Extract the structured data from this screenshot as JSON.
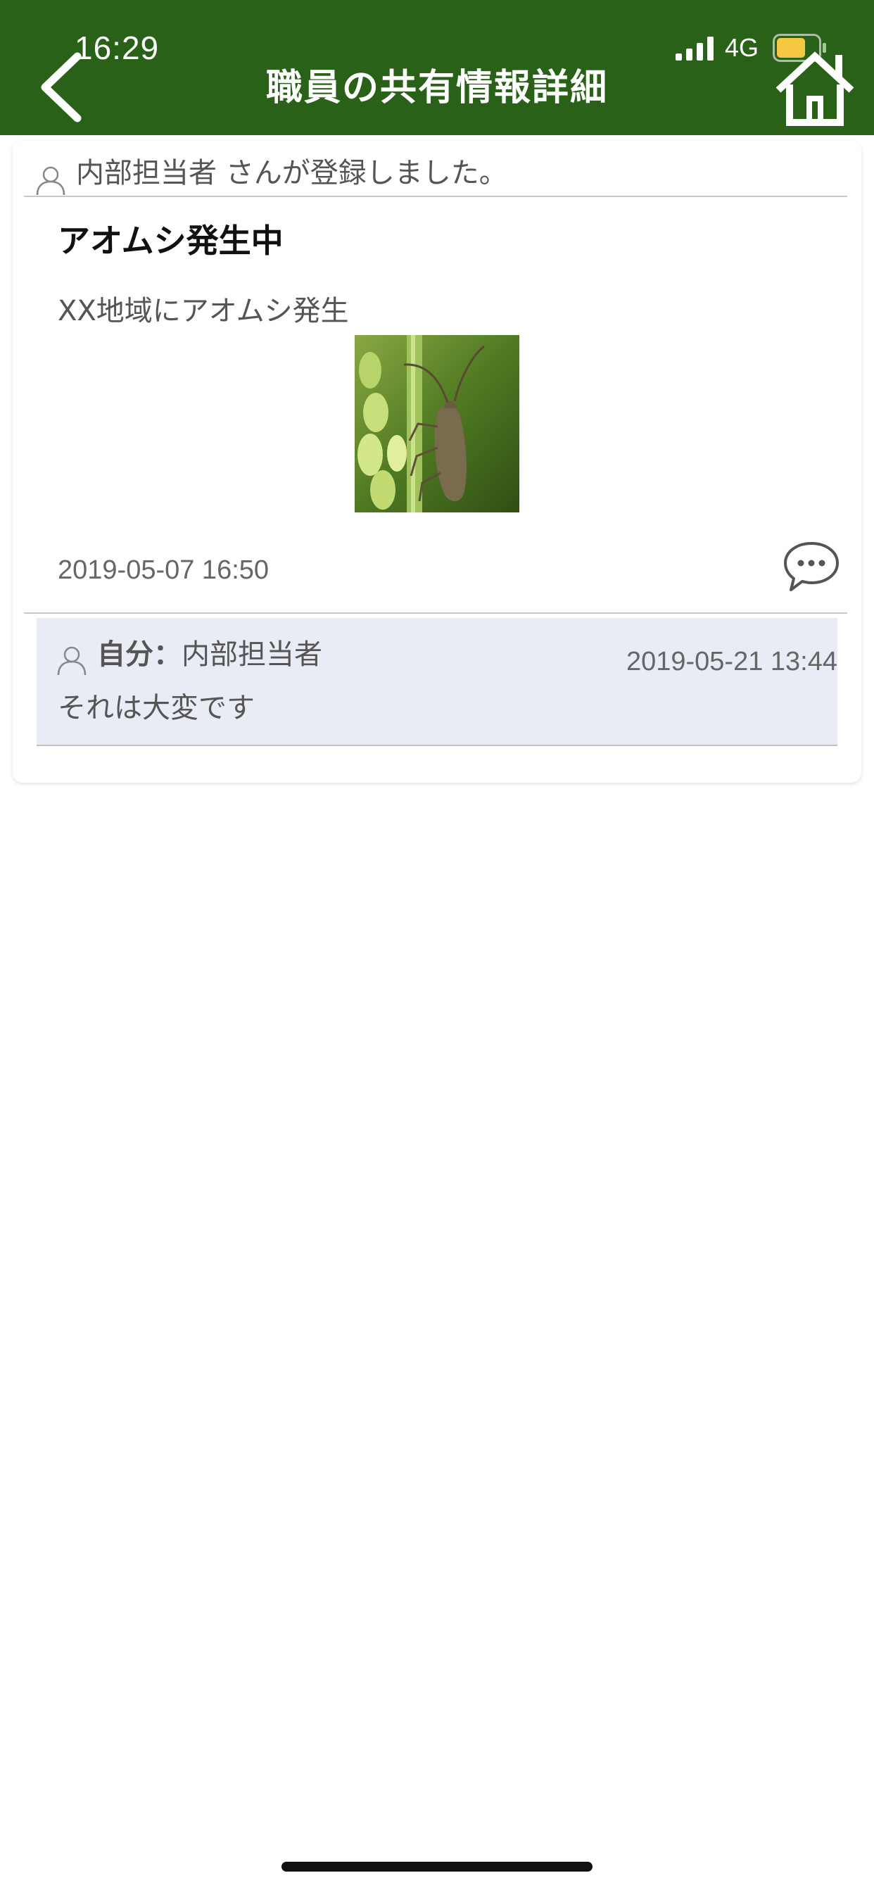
{
  "status_bar": {
    "time": "16:29",
    "network": "4G",
    "icons": [
      "signal-bars-icon",
      "battery-icon"
    ]
  },
  "header": {
    "title": "職員の共有情報詳細",
    "back_icon": "chevron-left-icon",
    "home_icon": "home-icon"
  },
  "post": {
    "registrant_text": "内部担当者 さんが登録しました。",
    "title": "アオムシ発生中",
    "body": "XX地域にアオムシ発生",
    "image_icon": "insect-photo",
    "date": "2019-05-07 16:50",
    "comment_icon": "speech-bubble-icon"
  },
  "comments": [
    {
      "author_label": "自分：",
      "author_name": "内部担当者",
      "date": "2019-05-21 13:44",
      "text": "それは大変です"
    }
  ],
  "colors": {
    "header_bg": "#2a6118",
    "comment_bg": "#e9ecf5",
    "battery": "#f5c842"
  }
}
